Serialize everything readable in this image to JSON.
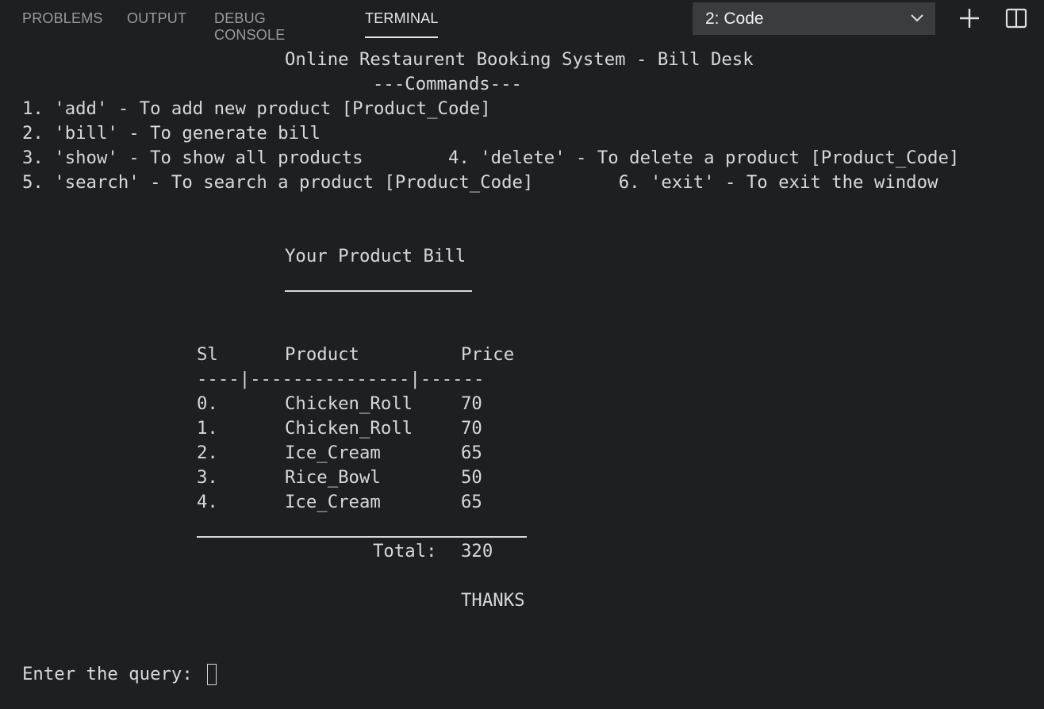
{
  "panel": {
    "tabs": [
      {
        "label": "PROBLEMS"
      },
      {
        "label": "OUTPUT"
      },
      {
        "label": "DEBUG CONSOLE"
      },
      {
        "label": "TERMINAL"
      }
    ],
    "terminal_select": "2: Code",
    "icons": {
      "add": "plus-icon",
      "split": "split-pane-icon",
      "dropdown": "chevron-down-icon"
    }
  },
  "terminal": {
    "header": "Online Restaurent Booking System - Bill Desk",
    "commands_title": "---Commands---",
    "commands": [
      "1. 'add' - To add new product [Product_Code]",
      "2. 'bill' - To generate bill",
      "3. 'show' - To show all products        4. 'delete' - To delete a product [Product_Code]",
      "5. 'search' - To search a product [Product_Code]        6. 'exit' - To exit the window"
    ],
    "bill_title": "Your Product Bill",
    "table": {
      "headers": {
        "sl": "Sl",
        "product": "Product",
        "price": "Price"
      },
      "separator": "----|---------------|------",
      "rows": [
        {
          "sl": "0.",
          "product": "Chicken_Roll",
          "price": "70"
        },
        {
          "sl": "1.",
          "product": "Chicken_Roll",
          "price": "70"
        },
        {
          "sl": "2.",
          "product": "Ice_Cream",
          "price": "65"
        },
        {
          "sl": "3.",
          "product": "Rice_Bowl",
          "price": "50"
        },
        {
          "sl": "4.",
          "product": "Ice_Cream",
          "price": "65"
        }
      ]
    },
    "total_label": "Total:",
    "total_value": "320",
    "thanks": "THANKS",
    "prompt": "Enter the query: "
  },
  "colors": {
    "background": "#1e1f21",
    "text": "#d8d8d8",
    "tab_inactive": "#9a9a9a",
    "dropdown_bg": "#3b3c3e"
  }
}
